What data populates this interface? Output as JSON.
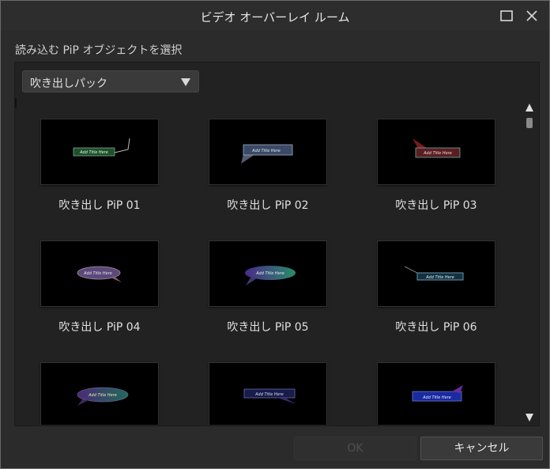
{
  "window": {
    "title": "ビデオ オーバーレイ ルーム"
  },
  "subtitle": "読み込む PiP オブジェクトを選択",
  "dropdown": {
    "selected": "吹き出しパック"
  },
  "items": [
    {
      "label": "吹き出し PiP 01",
      "thumb_text": "Add Title Here"
    },
    {
      "label": "吹き出し PiP 02",
      "thumb_text": "Add Title Here"
    },
    {
      "label": "吹き出し PiP 03",
      "thumb_text": "Add Title Here"
    },
    {
      "label": "吹き出し PiP 04",
      "thumb_text": "Add Title Here"
    },
    {
      "label": "吹き出し PiP 05",
      "thumb_text": "Add Title Here"
    },
    {
      "label": "吹き出し PiP 06",
      "thumb_text": "Add Title Here"
    },
    {
      "label": "",
      "thumb_text": "Add Title Here"
    },
    {
      "label": "",
      "thumb_text": "Add Title Here"
    },
    {
      "label": "",
      "thumb_text": "Add Title Here"
    }
  ],
  "buttons": {
    "ok": "OK",
    "cancel": "キャンセル"
  },
  "icons": {
    "maximize": "maximize-icon",
    "close": "close-icon",
    "dropdown": "triangle-down-icon",
    "scroll_up": "triangle-up-icon",
    "scroll_down": "triangle-down-icon"
  }
}
